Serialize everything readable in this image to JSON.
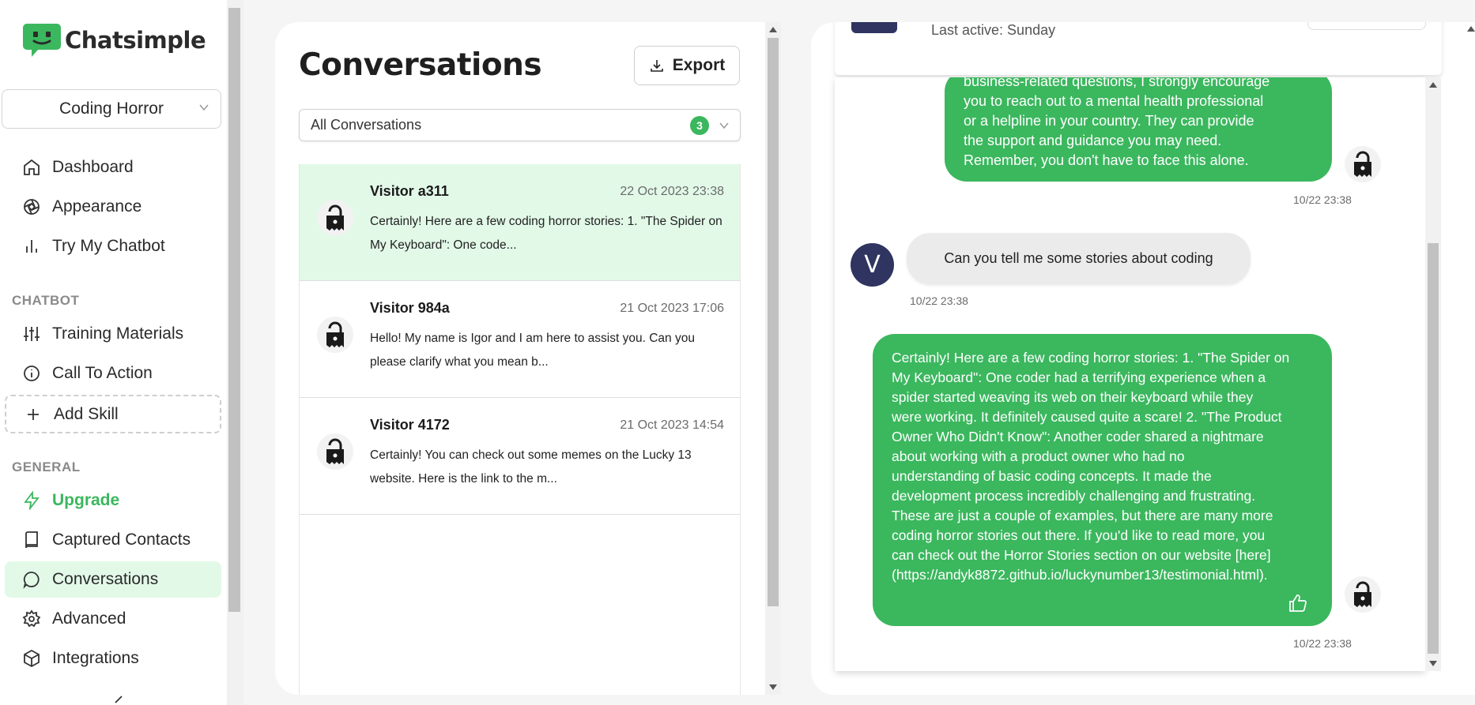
{
  "app": {
    "name": "Chatsimple",
    "brand_color": "#3bb75e",
    "accent_dark": "#2f3460"
  },
  "sidebar": {
    "bot_selector": {
      "value": "Coding Horror"
    },
    "main_items": [
      {
        "label": "Dashboard",
        "icon": "home-icon"
      },
      {
        "label": "Appearance",
        "icon": "aperture-icon"
      },
      {
        "label": "Try My Chatbot",
        "icon": "bar-chart-icon"
      }
    ],
    "section_chatbot": "CHATBOT",
    "chatbot_items": [
      {
        "label": "Training Materials",
        "icon": "sliders-icon"
      },
      {
        "label": "Call To Action",
        "icon": "info-icon"
      },
      {
        "label": "Add Skill",
        "icon": "plus-icon"
      }
    ],
    "section_general": "GENERAL",
    "general_items": [
      {
        "label": "Upgrade",
        "icon": "lightning-icon"
      },
      {
        "label": "Captured Contacts",
        "icon": "book-icon"
      },
      {
        "label": "Conversations",
        "icon": "chat-bubble-icon",
        "active": true
      },
      {
        "label": "Advanced",
        "icon": "gear-icon"
      },
      {
        "label": "Integrations",
        "icon": "cube-icon"
      }
    ]
  },
  "conversations_panel": {
    "title": "Conversations",
    "export_label": "Export",
    "filter": {
      "value": "All Conversations",
      "count": "3"
    },
    "items": [
      {
        "name": "Visitor a311",
        "time": "22 Oct 2023 23:38",
        "preview": "Certainly! Here are a few coding horror stories: 1. \"The Spider on My Keyboard\": One code...",
        "selected": true
      },
      {
        "name": "Visitor 984a",
        "time": "21 Oct 2023 17:06",
        "preview": "Hello! My name is Igor and I am here to assist you. Can you please clarify what you mean b..."
      },
      {
        "name": "Visitor 4172",
        "time": "21 Oct 2023 14:54",
        "preview": "Certainly! You can check out some memes on the Lucky 13 website. Here is the link to the m..."
      }
    ]
  },
  "chat": {
    "header": {
      "last_active": "Last active: Sunday"
    },
    "messages": [
      {
        "role": "bot",
        "lines": [
          "business-related questions, I strongly encourage",
          "you to reach out to a mental health professional",
          "or a helpline in your country. They can provide",
          "the support and guidance you may need.",
          "Remember, you don't have to face this alone."
        ],
        "time": "10/22 23:38"
      },
      {
        "role": "user",
        "avatar_letter": "V",
        "text": "Can you tell me some stories about coding",
        "time": "10/22 23:38"
      },
      {
        "role": "bot",
        "lines": [
          "Certainly! Here are a few coding horror stories: 1. \"The Spider on",
          "My Keyboard\": One coder had a terrifying experience when a",
          "spider started weaving its web on their keyboard while they",
          "were working. It definitely caused quite a scare! 2. \"The Product",
          "Owner Who Didn't Know\": Another coder shared a nightmare",
          "about working with a product owner who had no",
          "understanding of basic coding concepts. It made the",
          "development process incredibly challenging and frustrating.",
          "These are just a couple of examples, but there are many more",
          "coding horror stories out there. If you'd like to read more, you",
          "can check out the Horror Stories section on our website [here]",
          "(https://andyk8872.github.io/luckynumber13/testimonial.html)."
        ],
        "time": "10/22 23:38"
      }
    ]
  }
}
